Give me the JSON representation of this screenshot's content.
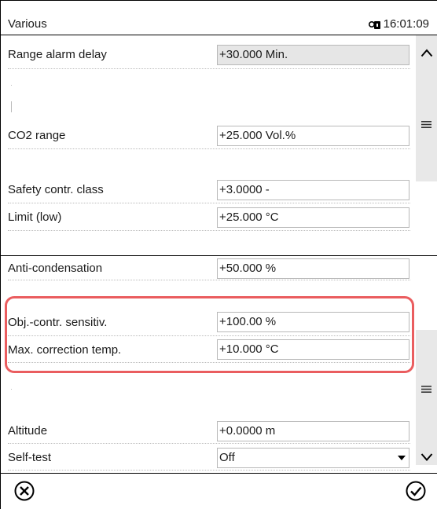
{
  "window": {
    "title": "Various",
    "time": "16:01:09",
    "lock_icon": "lock-icon"
  },
  "rows": {
    "range_alarm_delay": {
      "label": "Range alarm delay",
      "value": "+30.000 Min."
    },
    "co2_range": {
      "label": "CO2 range",
      "value": "+25.000 Vol.%"
    },
    "safety_class": {
      "label": "Safety contr. class",
      "value": "+3.0000 -"
    },
    "limit_low": {
      "label": "Limit (low)",
      "value": "+25.000 °C"
    },
    "anti_condensation": {
      "label": "Anti-condensation",
      "value": "+50.000 %"
    },
    "obj_sensitivity": {
      "label": "Obj.-contr. sensitiv.",
      "value": "+100.00 %"
    },
    "max_correction": {
      "label": "Max. correction temp.",
      "value": "+10.000 °C"
    },
    "altitude": {
      "label": "Altitude",
      "value": "+0.0000 m"
    },
    "self_test": {
      "label": "Self-test",
      "value": "Off"
    }
  },
  "highlight_color": "#ea5d5f",
  "icons": {
    "scroll_up": "chevron-up-icon",
    "scroll_down": "chevron-down-icon",
    "scroll_handle": "drag-handle-icon",
    "cancel": "cancel-circle-icon",
    "confirm": "checkmark-circle-icon"
  }
}
